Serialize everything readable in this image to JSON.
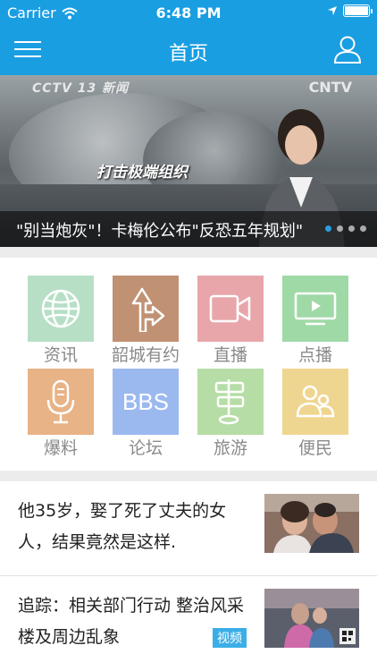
{
  "status_bar": {
    "carrier": "Carrier",
    "time": "6:48 PM"
  },
  "nav": {
    "title": "首页",
    "menu_icon": "hamburger-menu-icon",
    "user_icon": "user-profile-icon"
  },
  "banner": {
    "caption": "\"别当炮灰\"！卡梅伦公布\"反恐五年规划\"",
    "overlay_text": "打击极端组织",
    "logo_left": "CCTV 13 新闻",
    "logo_right": "CNTV",
    "page_count": 4,
    "active_page": 1
  },
  "grid": [
    {
      "label": "资讯",
      "icon": "globe-icon",
      "color": "#b7dfc6"
    },
    {
      "label": "韶城有约",
      "icon": "road-sign-icon",
      "color": "#c09173"
    },
    {
      "label": "直播",
      "icon": "video-camera-icon",
      "color": "#e8a6ab"
    },
    {
      "label": "点播",
      "icon": "tv-play-icon",
      "color": "#9fd9a6"
    },
    {
      "label": "爆料",
      "icon": "microphone-icon",
      "color": "#e8b387"
    },
    {
      "label": "论坛",
      "icon": "bbs-icon",
      "text": "BBS",
      "color": "#9cb9ef"
    },
    {
      "label": "旅游",
      "icon": "signpost-icon",
      "color": "#b6dda5"
    },
    {
      "label": "便民",
      "icon": "people-icon",
      "color": "#efd690"
    }
  ],
  "news": [
    {
      "title": "他35岁，娶了死了丈夫的女人，结果竟然是这样.",
      "thumb": "news-thumbnail-couple"
    },
    {
      "title": "追踪：相关部门行动 整治风采楼及周边乱象",
      "tag": "视频",
      "thumb": "news-thumbnail-mall"
    }
  ],
  "colors": {
    "accent": "#1a9ee2",
    "separator": "#ececec"
  }
}
